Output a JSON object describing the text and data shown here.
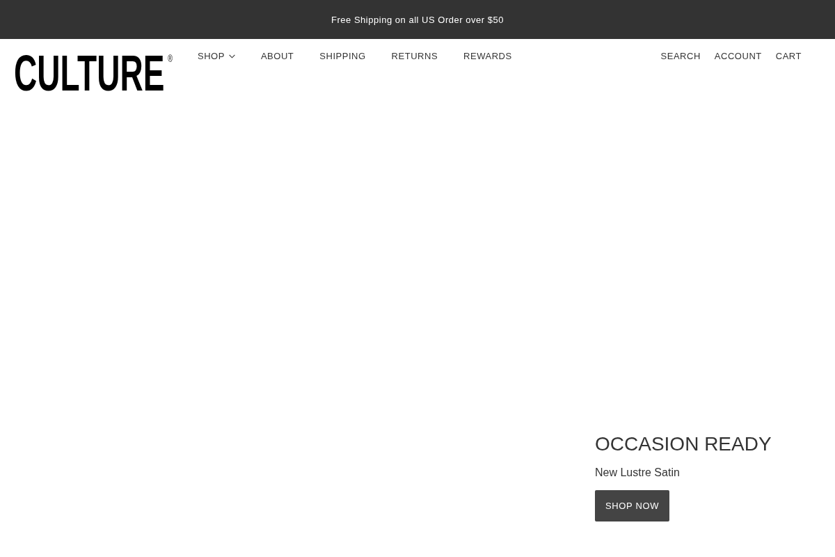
{
  "announcement_bar": {
    "text": "Free Shipping on all US Order over $50"
  },
  "header": {
    "logo": {
      "text": "CULTURE",
      "mark": "®"
    },
    "nav": [
      {
        "label": "SHOP",
        "dropdown": true
      },
      {
        "label": "ABOUT",
        "dropdown": false
      },
      {
        "label": "SHIPPING",
        "dropdown": false
      },
      {
        "label": "RETURNS",
        "dropdown": false
      },
      {
        "label": "REWARDS",
        "dropdown": false
      }
    ],
    "utility_links": [
      "SEARCH",
      "ACCOUNT",
      "CART"
    ]
  },
  "hero": {
    "title": "OCCASION READY",
    "subtitle": "New Lustre Satin",
    "button": "SHOP NOW"
  }
}
